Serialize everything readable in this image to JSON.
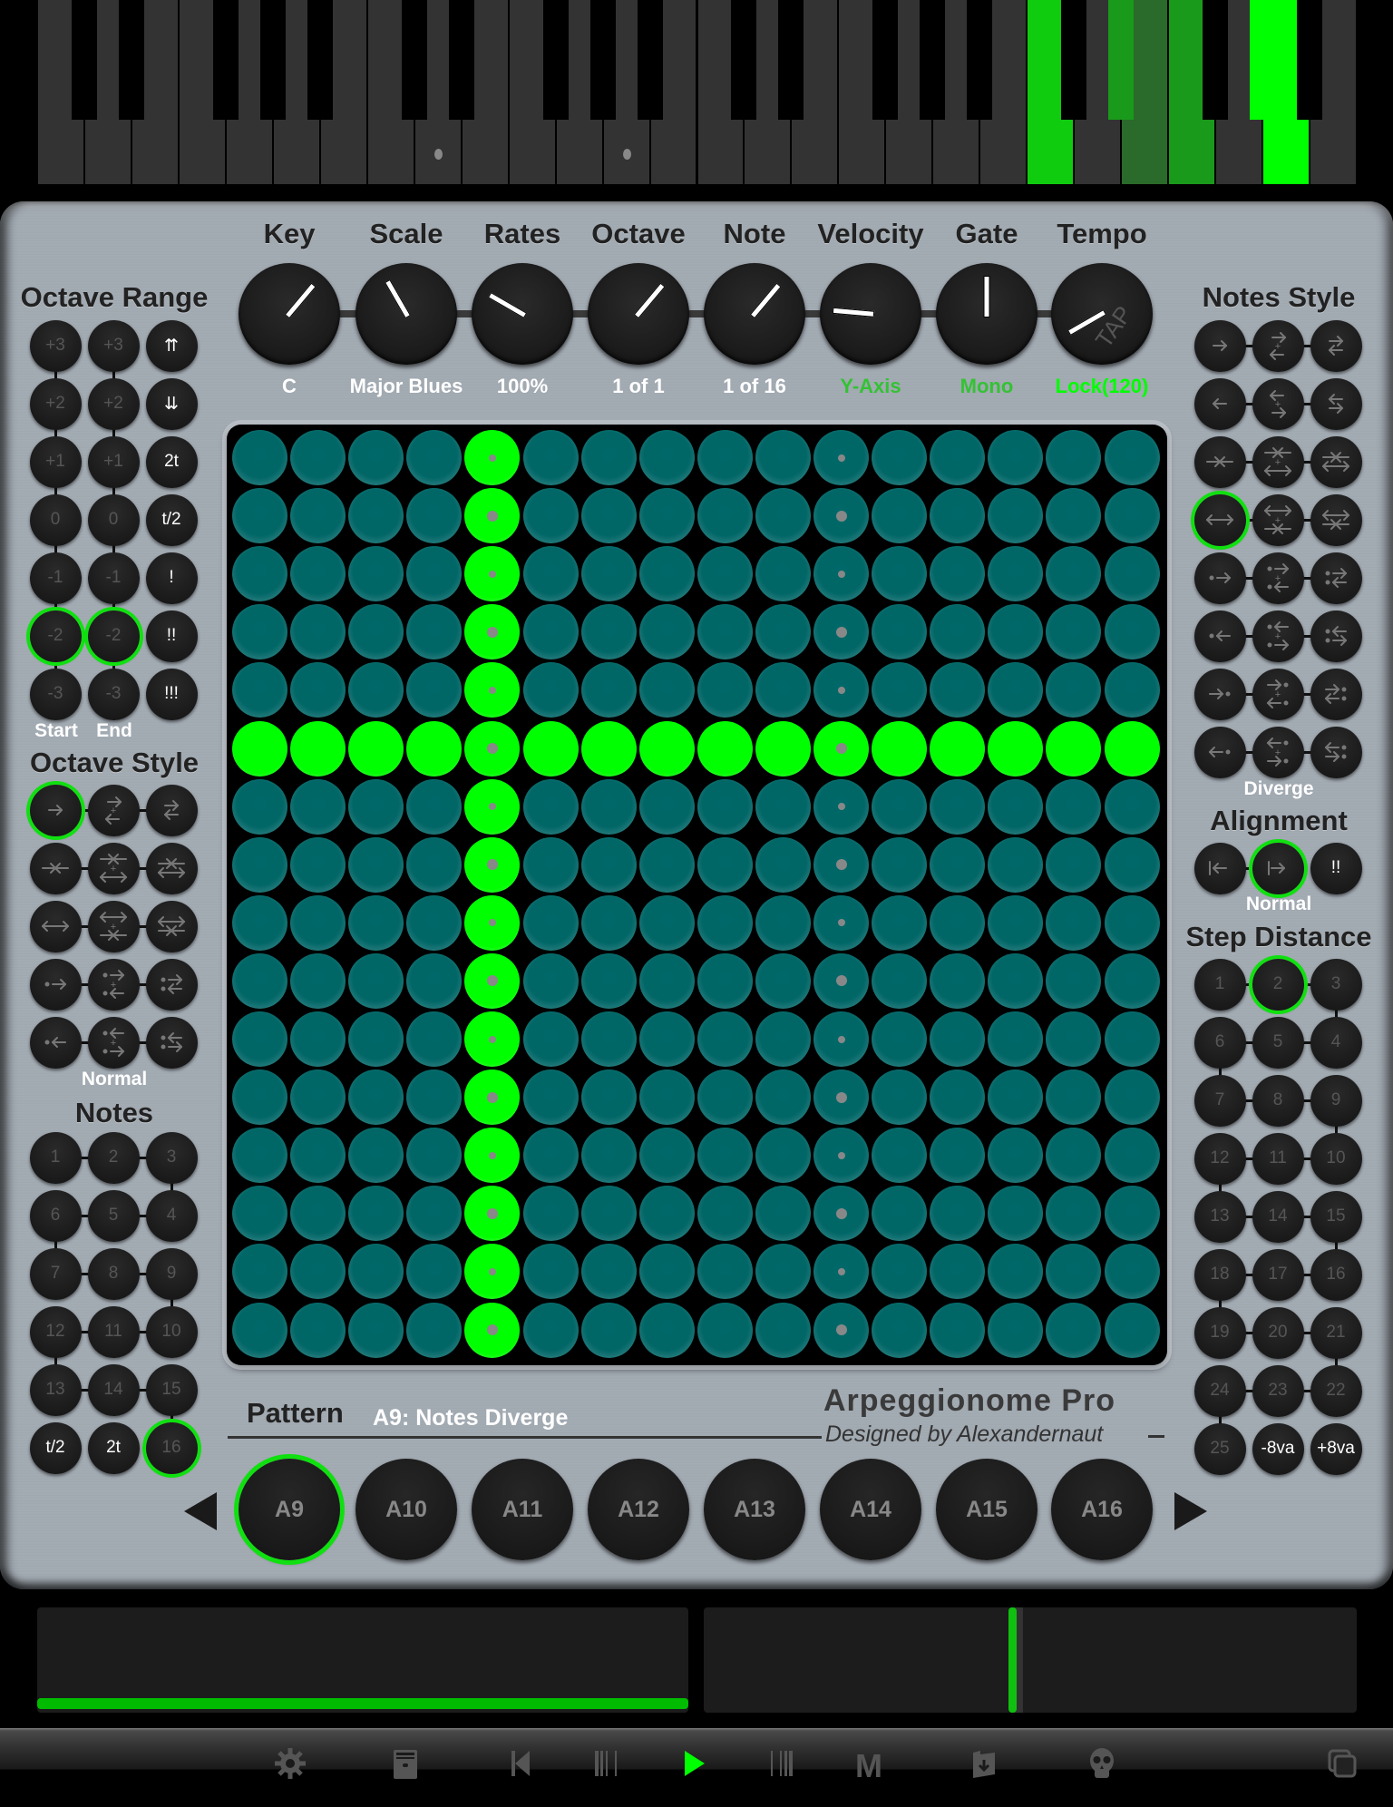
{
  "piano": {
    "white_key_count": 28,
    "active_keys": [
      {
        "index": 8,
        "state": "marker"
      },
      {
        "index": 12,
        "state": "marker"
      },
      {
        "index": 21,
        "state": "playing-bright"
      },
      {
        "index": 23,
        "state": "playing-dim"
      },
      {
        "index": 24,
        "state": "playing-mid"
      },
      {
        "index": 26,
        "state": "playing-full"
      }
    ]
  },
  "knobs": [
    {
      "name": "key",
      "label": "Key",
      "value": "C",
      "value_color": "white",
      "angle": 220
    },
    {
      "name": "scale",
      "label": "Scale",
      "value": "Major Blues",
      "value_color": "white",
      "angle": 150
    },
    {
      "name": "rates",
      "label": "Rates",
      "value": "100%",
      "value_color": "white",
      "angle": 120
    },
    {
      "name": "octave",
      "label": "Octave",
      "value": "1 of 1",
      "value_color": "white",
      "angle": 220
    },
    {
      "name": "note",
      "label": "Note",
      "value": "1 of 16",
      "value_color": "white",
      "angle": 220
    },
    {
      "name": "velocity",
      "label": "Velocity",
      "value": "Y-Axis",
      "value_color": "dimgreen",
      "angle": 95
    },
    {
      "name": "gate",
      "label": "Gate",
      "value": "Mono",
      "value_color": "dimgreen",
      "angle": 180
    },
    {
      "name": "tempo",
      "label": "Tempo",
      "value": "Lock(120)",
      "value_color": "green",
      "angle": 60,
      "overlay": "TAP"
    }
  ],
  "left": {
    "octave_range": {
      "title": "Octave Range",
      "start_label": "Start",
      "end_label": "End",
      "start_values": [
        "+3",
        "+2",
        "+1",
        "0",
        "-1",
        "-2",
        "-3"
      ],
      "end_values": [
        "+3",
        "+2",
        "+1",
        "0",
        "-1",
        "-2",
        "-3"
      ],
      "extra_buttons": [
        "⇈",
        "⇊",
        "2t",
        "t/2",
        "!",
        "!!",
        "!!!"
      ],
      "selected_start": "-2",
      "selected_end": "-2"
    },
    "octave_style": {
      "title": "Octave Style",
      "status": "Normal",
      "selected_index": 0,
      "icons": [
        "right-arrow-icon",
        "right-plus-left-icon",
        "right-left-icon",
        "converge-icon",
        "converge-plus-diverge-icon",
        "converge-diverge-icon",
        "diverge-icon",
        "diverge-plus-converge-icon",
        "diverge-converge-icon",
        "dot-right-icon",
        "dot-right-plus-dot-left-icon",
        "dot-right-dot-left-icon",
        "dot-left-icon",
        "dot-left-plus-dot-right-icon",
        "dot-left-dot-right-icon"
      ]
    },
    "notes": {
      "title": "Notes",
      "rows": [
        [
          "1",
          "2",
          "3"
        ],
        [
          "6",
          "5",
          "4"
        ],
        [
          "7",
          "8",
          "9"
        ],
        [
          "12",
          "11",
          "10"
        ],
        [
          "13",
          "14",
          "15"
        ],
        [
          "t/2",
          "2t",
          "16"
        ]
      ],
      "selected": "16"
    }
  },
  "right": {
    "notes_style": {
      "title": "Notes Style",
      "status": "Diverge",
      "selected_index": 9,
      "icons": [
        "right-arrow-icon",
        "right-plus-left-icon",
        "right-left-icon",
        "left-arrow-icon",
        "left-plus-right-icon",
        "left-right-icon",
        "converge-icon",
        "converge-plus-diverge-icon",
        "converge-diverge-icon",
        "diverge-icon",
        "diverge-plus-converge-icon",
        "diverge-converge-icon",
        "dot-right-icon",
        "dot-right-plus-dot-left-icon",
        "dot-right-dot-left-icon",
        "dot-left-icon",
        "dot-left-plus-dot-right-icon",
        "dot-left-dot-right-icon",
        "right-dot-icon",
        "right-dot-plus-left-dot-icon",
        "right-dot-left-dot-icon",
        "left-dot-icon",
        "left-dot-plus-right-dot-icon",
        "left-dot-right-dot-icon"
      ]
    },
    "alignment": {
      "title": "Alignment",
      "status": "Normal",
      "buttons": [
        "align-left-icon",
        "align-right-icon",
        "!!"
      ],
      "selected_index": 1
    },
    "step_distance": {
      "title": "Step Distance",
      "rows": [
        [
          "1",
          "2",
          "3"
        ],
        [
          "6",
          "5",
          "4"
        ],
        [
          "7",
          "8",
          "9"
        ],
        [
          "12",
          "11",
          "10"
        ],
        [
          "13",
          "14",
          "15"
        ],
        [
          "18",
          "17",
          "16"
        ],
        [
          "19",
          "20",
          "21"
        ],
        [
          "24",
          "23",
          "22"
        ],
        [
          "25",
          "-8va",
          "+8va"
        ]
      ],
      "selected": "2"
    }
  },
  "grid": {
    "rows": 16,
    "cols": 16,
    "active_col": 4,
    "active_row": 5,
    "marker_cols": [
      4,
      10
    ],
    "marker_pattern": [
      "s",
      "l",
      "s",
      "l",
      "s",
      "l",
      "s",
      "l",
      "s",
      "l",
      "s",
      "l",
      "s",
      "l",
      "s",
      "l"
    ]
  },
  "pattern": {
    "label": "Pattern",
    "name": "A9: Notes Diverge",
    "buttons": [
      "A9",
      "A10",
      "A11",
      "A12",
      "A13",
      "A14",
      "A15",
      "A16"
    ],
    "selected": "A9"
  },
  "branding": {
    "title": "Arpeggionome Pro",
    "credit": "Designed by Alexandernaut"
  },
  "meters": {
    "left_level": 1.0,
    "right_position": 0.48
  },
  "toolbar": {
    "items": [
      {
        "name": "settings",
        "icon": "gear-icon"
      },
      {
        "name": "archive",
        "icon": "file-cabinet-icon"
      },
      {
        "name": "rewind",
        "icon": "skip-back-icon"
      },
      {
        "name": "bar-left",
        "icon": "bar-lines-left-icon"
      },
      {
        "name": "play",
        "icon": "play-icon",
        "active": true
      },
      {
        "name": "bar-right",
        "icon": "bar-lines-right-icon"
      },
      {
        "name": "midi",
        "icon": "midi-m-icon"
      },
      {
        "name": "import",
        "icon": "folder-import-icon"
      },
      {
        "name": "panic",
        "icon": "skull-icon"
      },
      {
        "name": "windows",
        "icon": "windows-icon"
      }
    ]
  },
  "colors": {
    "accent_green": "#00ff00",
    "selection_ring": "#10e010",
    "pad_teal": "#006666",
    "panel_silver": "#a2aab2",
    "button_dark": "#1b1b1b"
  }
}
